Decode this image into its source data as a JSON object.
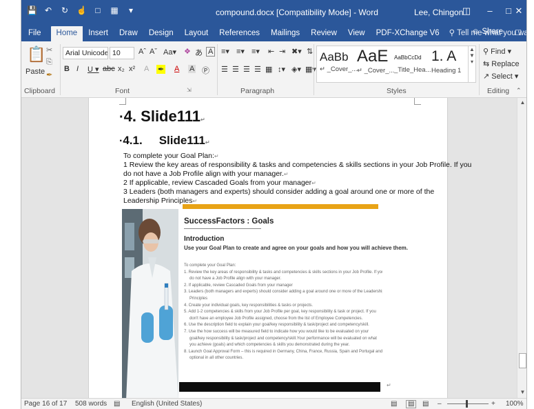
{
  "app": {
    "title": "compound.docx [Compatibility Mode]  -  Word",
    "user": "Lee, Chingon"
  },
  "tabs": [
    "File",
    "Home",
    "Insert",
    "Draw",
    "Design",
    "Layout",
    "References",
    "Mailings",
    "Review",
    "View",
    "PDF-XChange V6"
  ],
  "active_tab": "Home",
  "tell_me": "Tell me what you want to do",
  "share": "Share",
  "ribbon": {
    "clipboard": {
      "label": "Clipboard",
      "paste": "Paste"
    },
    "font": {
      "label": "Font",
      "family": "Arial Unicode",
      "size": "10"
    },
    "paragraph": {
      "label": "Paragraph"
    },
    "styles": {
      "label": "Styles",
      "items": [
        {
          "sample": "AaBb",
          "name": "↵ _Cover_..."
        },
        {
          "sample": "AaE",
          "name": "↵ _Cover_..."
        },
        {
          "sample": "AaBbCcDd",
          "name": "_Title_Hea..."
        },
        {
          "sample": "1. A",
          "name": "Heading 1"
        }
      ]
    },
    "editing": {
      "label": "Editing",
      "find": "Find",
      "replace": "Replace",
      "select": "Select"
    }
  },
  "document": {
    "heading1": {
      "num": "4.",
      "text": "Slide111"
    },
    "heading2": {
      "num": "4.1.",
      "text": "Slide111"
    },
    "body": [
      "To complete your Goal Plan:",
      "1 Review the key areas of responsibility & tasks and competencies & skills sections in your Job Profile. If you",
      "do not have a Job Profile align with your manager.",
      "2 If applicable, review Cascaded Goals from your manager",
      "3 Leaders (both managers and experts) should consider adding a goal around one or more of the",
      "Leadership Principles"
    ],
    "embedded": {
      "title": "SuccessFactors : Goals",
      "section": "Introduction",
      "lead": "Use your Goal Plan to create and agree on your goals and how you will achieve them.",
      "lines": [
        {
          "text": "To complete your Goal Plan:",
          "indent": false
        },
        {
          "text": "1. Review the key areas of responsibility & tasks and competencies & skills sections in your Job Profile. If you",
          "indent": false
        },
        {
          "text": "do not have a Job Profile align with your manager.",
          "indent": true
        },
        {
          "text": "2. If applicable, review Cascaded Goals from your manager",
          "indent": false
        },
        {
          "text": "3. Leaders (both managers and experts) should consider adding a goal around one or more of the Leadership",
          "indent": false
        },
        {
          "text": "Principles",
          "indent": true
        },
        {
          "text": "4. Create your individual goals, key responsibilities & tasks or projects.",
          "indent": false
        },
        {
          "text": "5. Add 1-2 competencies & skills from your Job Profile per goal, key responsibility & task or project. If you",
          "indent": false
        },
        {
          "text": "don't have an employee Job Profile assigned, choose from the list of Employee Competencies.",
          "indent": true
        },
        {
          "text": "6. Use the description field to explain your goal/key responsibility & task/project and competency/skill.",
          "indent": false
        },
        {
          "text": "7. Use the how success will be measured field to indicate how you would like to be evaluated on your",
          "indent": false
        },
        {
          "text": "goal/key responsibility & task/project and competency/skill.Your performance will be evaluated on what",
          "indent": true
        },
        {
          "text": "you achieve (goals) and which competencies & skills you demonstrated during the year.",
          "indent": true
        },
        {
          "text": "8. Launch Goal Approval Form – this is required in Germany, China, France, Russia, Spain and Portugal and",
          "indent": false
        },
        {
          "text": "optional in all other countries.",
          "indent": true
        }
      ]
    }
  },
  "status": {
    "page": "Page 16 of 17",
    "words": "508 words",
    "language": "English (United States)",
    "zoom": "100%"
  },
  "colors": {
    "titlebar": "#2b579a",
    "accent_bar": "#e8a316"
  }
}
